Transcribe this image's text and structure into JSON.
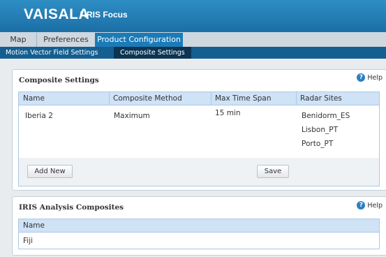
{
  "header": {
    "brand": "VAISALA",
    "product": "/ IRIS Focus"
  },
  "main_tabs": [
    {
      "label": "Map"
    },
    {
      "label": "Preferences"
    },
    {
      "label": "Product Configuration"
    }
  ],
  "sub_tabs": [
    {
      "label": "Motion Vector Field Settings"
    },
    {
      "label": "Composite Settings"
    }
  ],
  "composite_panel": {
    "title": "Composite Settings",
    "help_label": "Help",
    "columns": [
      "Name",
      "Composite Method",
      "Max Time Span",
      "Radar Sites"
    ],
    "rows": [
      {
        "name": "Iberia 2",
        "method": "Maximum",
        "time_span": "15 min",
        "radar_sites": [
          "Benidorm_ES",
          "Lisbon_PT",
          "Porto_PT"
        ]
      }
    ],
    "add_new_label": "Add New",
    "save_label": "Save"
  },
  "analysis_panel": {
    "title": "IRIS Analysis Composites",
    "help_label": "Help",
    "column": "Name",
    "rows": [
      "Fiji"
    ]
  },
  "colors": {
    "header": "#1b6fa5",
    "active_tab": "#1b7bb8",
    "sub_bar": "#155f90",
    "active_sub_tab": "#0b3552",
    "grid_header": "#cfe2f6"
  }
}
